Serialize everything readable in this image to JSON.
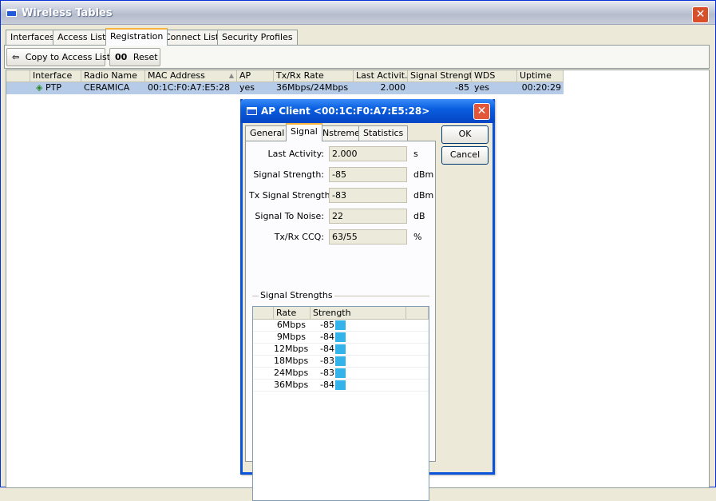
{
  "window": {
    "title": "Wireless Tables",
    "close_glyph": "✕"
  },
  "tabs": [
    "Interfaces",
    "Access List",
    "Registration",
    "Connect List",
    "Security Profiles"
  ],
  "toolbar": {
    "copy_label": "Copy to Access List",
    "reset_icon_text": "00",
    "reset_label": "Reset"
  },
  "table": {
    "headers": [
      "Interface",
      "Radio Name",
      "MAC Address",
      "AP",
      "Tx/Rx Rate",
      "Last Activit...",
      "Signal Strengt...",
      "WDS",
      "Uptime"
    ],
    "row": {
      "interface": "PTP",
      "radio_name": "CERAMICA",
      "mac": "00:1C:F0:A7:E5:28",
      "ap": "yes",
      "rate": "36Mbps/24Mbps",
      "last_activity": "2.000",
      "signal": "-85",
      "wds": "yes",
      "uptime": "00:20:29"
    }
  },
  "dialog": {
    "title": "AP Client <00:1C:F0:A7:E5:28>",
    "close_glyph": "✕",
    "tabs": [
      "General",
      "Signal",
      "Nstreme",
      "Statistics"
    ],
    "ok_label": "OK",
    "cancel_label": "Cancel",
    "fields": [
      {
        "label": "Last Activity:",
        "value": "2.000",
        "unit": "s"
      },
      {
        "label": "Signal Strength:",
        "value": "-85",
        "unit": "dBm"
      },
      {
        "label": "Tx Signal Strength:",
        "value": "-83",
        "unit": "dBm"
      },
      {
        "label": "Signal To Noise:",
        "value": "22",
        "unit": "dB"
      },
      {
        "label": "Tx/Rx CCQ:",
        "value": "63/55",
        "unit": "%"
      }
    ],
    "group_label": "Signal Strengths",
    "strength_headers": [
      "Rate",
      "Strength"
    ],
    "strengths": [
      {
        "rate": "6Mbps",
        "strength": "-85"
      },
      {
        "rate": "9Mbps",
        "strength": "-84"
      },
      {
        "rate": "12Mbps",
        "strength": "-84"
      },
      {
        "rate": "18Mbps",
        "strength": "-83"
      },
      {
        "rate": "24Mbps",
        "strength": "-83"
      },
      {
        "rate": "36Mbps",
        "strength": "-84"
      }
    ]
  },
  "colors": {
    "selection": "#b5cbe8",
    "strength_bar": "#33b3ea",
    "dialog_title": "#0a5fe0"
  }
}
